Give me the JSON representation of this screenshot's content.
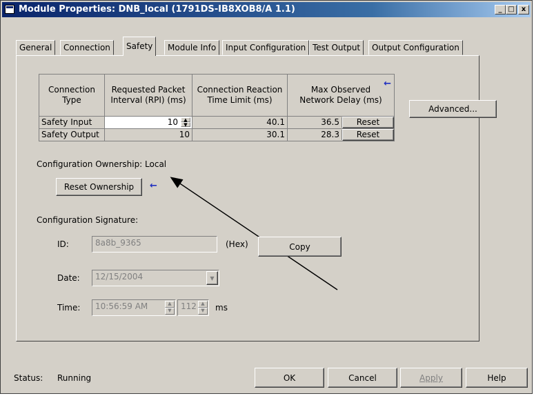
{
  "window": {
    "title": "Module Properties: DNB_local (1791DS-IB8XOB8/A 1.1)",
    "title_buttons": [
      "_",
      "□",
      "x"
    ]
  },
  "tabs": [
    {
      "label": "General",
      "active": false
    },
    {
      "label": "Connection",
      "active": false
    },
    {
      "label": "Safety",
      "active": true
    },
    {
      "label": "Module Info",
      "active": false
    },
    {
      "label": "Input Configuration",
      "active": false
    },
    {
      "label": "Test Output",
      "active": false
    },
    {
      "label": "Output Configuration",
      "active": false
    }
  ],
  "table": {
    "headers": [
      "Connection\nType",
      "Requested Packet\nInterval (RPI) (ms)",
      "Connection Reaction\nTime Limit (ms)",
      "Max Observed\nNetwork Delay (ms)"
    ],
    "rows": [
      {
        "type": "Safety Input",
        "rpi": "10",
        "limit": "40.1",
        "delay": "36.5",
        "reset": "Reset"
      },
      {
        "type": "Safety Output",
        "rpi": "10",
        "limit": "30.1",
        "delay": "28.3",
        "reset": "Reset"
      }
    ]
  },
  "advanced_label": "Advanced...",
  "ownership": {
    "label": "Configuration Ownership: Local",
    "reset_button": "Reset Ownership"
  },
  "signature": {
    "heading": "Configuration Signature:",
    "id_label": "ID:",
    "id_value": "8a8b_9365",
    "hex_label": "(Hex)",
    "copy_button": "Copy",
    "date_label": "Date:",
    "date_value": "12/15/2004",
    "time_label": "Time:",
    "time_value": "10:56:59 AM",
    "ms_value": "112",
    "ms_label": "ms"
  },
  "footer": {
    "status_label": "Status:",
    "status_value": "Running",
    "ok": "OK",
    "cancel": "Cancel",
    "apply": "Apply",
    "help": "Help"
  },
  "arrow_glyph": "←",
  "colors": {
    "title_start": "#0a246a",
    "title_end": "#a6caf0",
    "face": "#d4d0c8",
    "annotation_arrow": "#2030c0"
  }
}
